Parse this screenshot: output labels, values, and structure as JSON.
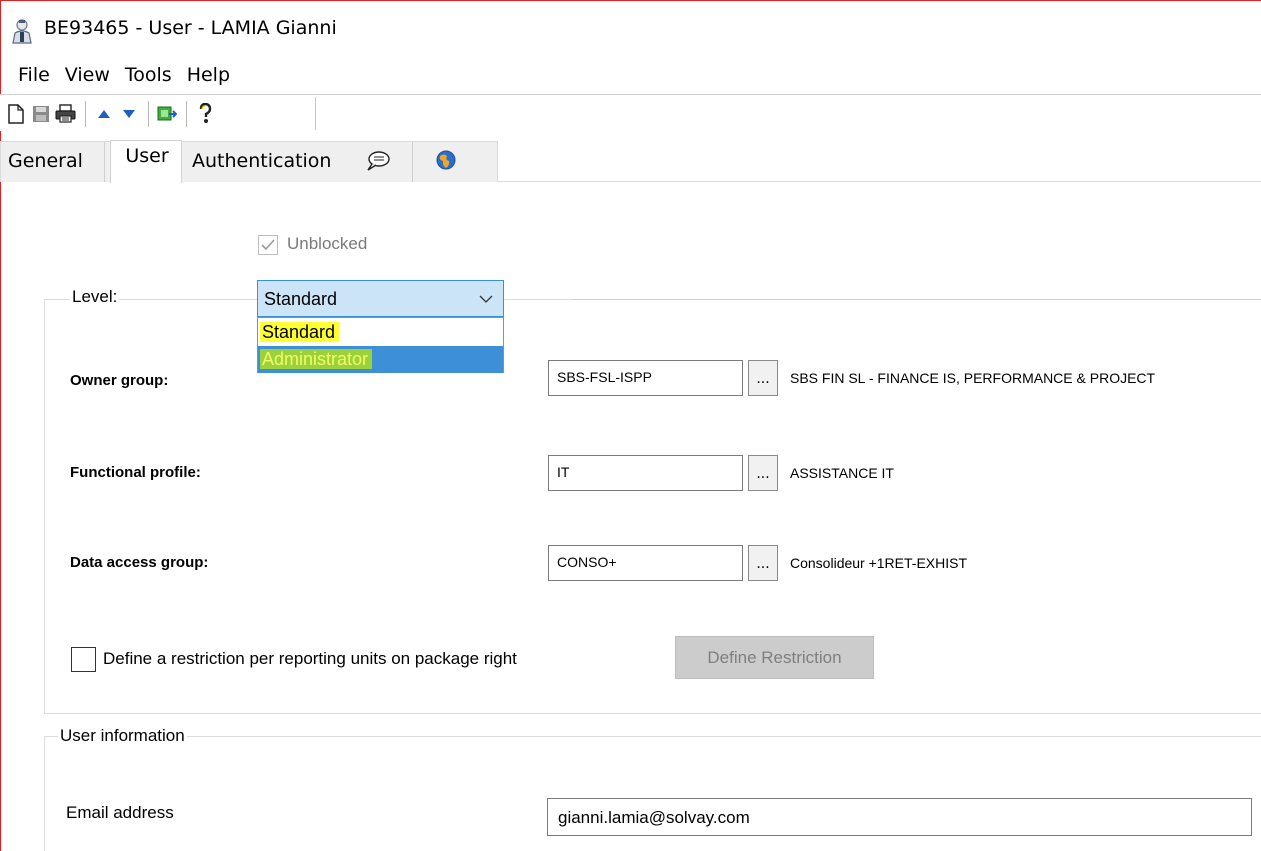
{
  "window": {
    "title": "BE93465 - User - LAMIA Gianni",
    "app_icon": "user-icon"
  },
  "menu": [
    "File",
    "View",
    "Tools",
    "Help"
  ],
  "toolbar": {
    "icons": [
      "new-document-icon",
      "save-icon",
      "print-icon",
      "arrow-up-icon",
      "arrow-down-icon",
      "export-icon",
      "help-icon"
    ]
  },
  "tabs": {
    "general": "General",
    "user": "User",
    "authentication": "Authentication",
    "comment_icon": "comment-icon",
    "globe_icon": "globe-icon",
    "active": "User"
  },
  "form": {
    "unblocked": {
      "label": "Unblocked",
      "checked": true,
      "enabled": false
    },
    "level": {
      "label": "Level:",
      "value": "Standard",
      "options": [
        "Standard",
        "Administrator"
      ],
      "highlighted_option": "Administrator"
    },
    "owner_group": {
      "label": "Owner group:",
      "code": "SBS-FSL-ISPP",
      "browse": "...",
      "description": "SBS FIN SL - FINANCE IS, PERFORMANCE & PROJECT"
    },
    "functional_profile": {
      "label": "Functional profile:",
      "code": "IT",
      "browse": "...",
      "description": "ASSISTANCE IT"
    },
    "data_access_group": {
      "label": "Data access group:",
      "code": "CONSO+",
      "browse": "...",
      "description": "Consolideur +1RET-EXHIST"
    },
    "restriction": {
      "label": "Define a restriction per reporting units on package right",
      "checked": false,
      "button": "Define Restriction"
    }
  },
  "user_information": {
    "legend": "User information",
    "email_label": "Email address",
    "email_value": "gianni.lamia@solvay.com"
  },
  "colors": {
    "frame_border": "#e02020",
    "select_bg": "#cce4f7",
    "select_border": "#3c8fd4",
    "highlight_yellow": "#ffff33",
    "selected_option_bg": "#3d8fd6",
    "highlight_green": "#9bd23c"
  }
}
